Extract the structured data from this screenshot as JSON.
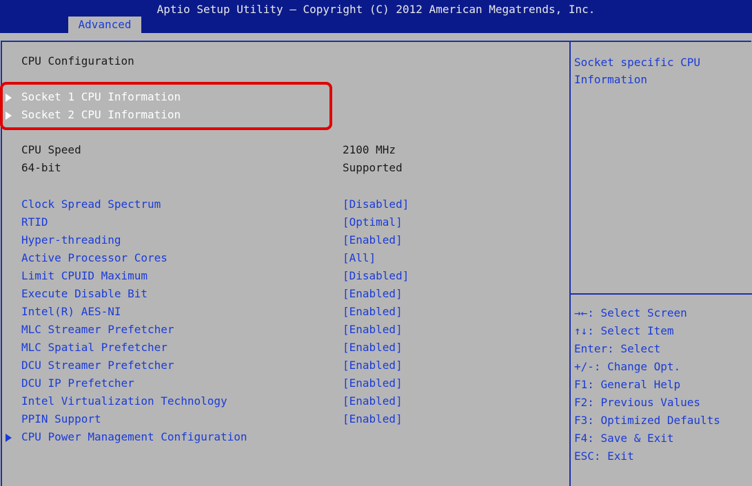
{
  "header": {
    "title": "Aptio Setup Utility – Copyright (C) 2012 American Megatrends, Inc.",
    "active_tab": "Advanced"
  },
  "colors": {
    "header_bg": "#0b1a8a",
    "panel_bg": "#b6b6b6",
    "accent": "#1a3bd8",
    "highlight": "#e00000"
  },
  "page_title": "CPU Configuration",
  "submenus": [
    {
      "label": "Socket 1 CPU Information",
      "icon": "triangle-right-icon"
    },
    {
      "label": "Socket 2 CPU Information",
      "icon": "triangle-right-icon"
    }
  ],
  "info": [
    {
      "label": "CPU Speed",
      "value": "2100 MHz"
    },
    {
      "label": "64-bit",
      "value": "Supported"
    }
  ],
  "options": [
    {
      "label": "Clock Spread Spectrum",
      "value": "[Disabled]"
    },
    {
      "label": "RTID",
      "value": "[Optimal]"
    },
    {
      "label": "Hyper-threading",
      "value": "[Enabled]"
    },
    {
      "label": "Active Processor Cores",
      "value": "[All]"
    },
    {
      "label": "Limit CPUID Maximum",
      "value": "[Disabled]"
    },
    {
      "label": "Execute Disable Bit",
      "value": "[Enabled]"
    },
    {
      "label": "Intel(R) AES-NI",
      "value": "[Enabled]"
    },
    {
      "label": "MLC Streamer Prefetcher",
      "value": "[Enabled]"
    },
    {
      "label": "MLC Spatial Prefetcher",
      "value": "[Enabled]"
    },
    {
      "label": "DCU Streamer Prefetcher",
      "value": "[Enabled]"
    },
    {
      "label": "DCU IP Prefetcher",
      "value": "[Enabled]"
    },
    {
      "label": "Intel Virtualization Technology",
      "value": "[Enabled]"
    },
    {
      "label": "PPIN Support",
      "value": "[Enabled]"
    }
  ],
  "power_menu": {
    "label": "CPU Power Management Configuration",
    "icon": "triangle-right-icon"
  },
  "help": {
    "line1": "Socket specific CPU",
    "line2": "Information"
  },
  "keys": [
    "→←: Select Screen",
    "↑↓: Select Item",
    "Enter: Select",
    "+/-: Change Opt.",
    "F1: General Help",
    "F2: Previous Values",
    "F3: Optimized Defaults",
    "F4: Save & Exit",
    "ESC: Exit"
  ]
}
